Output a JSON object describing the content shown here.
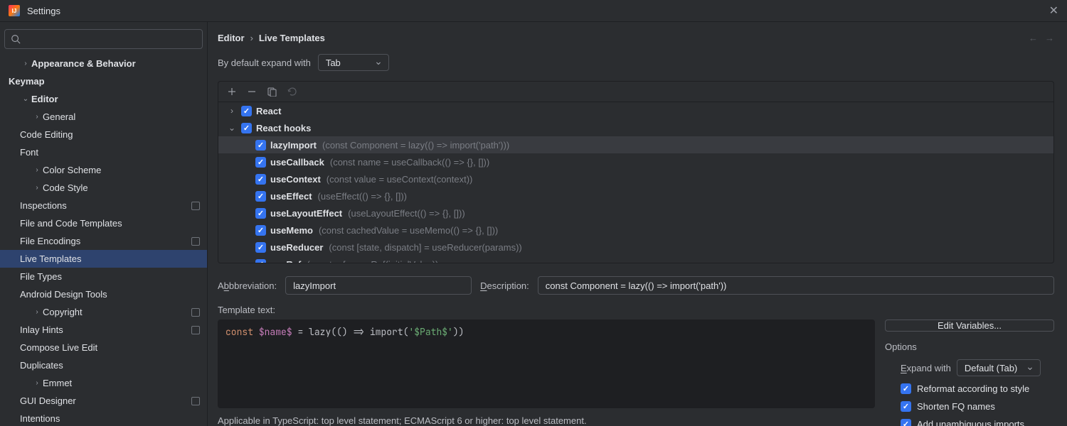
{
  "window": {
    "title": "Settings"
  },
  "search": {
    "placeholder": ""
  },
  "sidebar": [
    {
      "label": "Appearance & Behavior",
      "indent": 1,
      "chev": "›",
      "bold": true
    },
    {
      "label": "Keymap",
      "indent": 1,
      "bold": true
    },
    {
      "label": "Editor",
      "indent": 1,
      "chev": "⌄",
      "bold": true
    },
    {
      "label": "General",
      "indent": 2,
      "chev": "›"
    },
    {
      "label": "Code Editing",
      "indent": 2
    },
    {
      "label": "Font",
      "indent": 2
    },
    {
      "label": "Color Scheme",
      "indent": 2,
      "chev": "›"
    },
    {
      "label": "Code Style",
      "indent": 2,
      "chev": "›"
    },
    {
      "label": "Inspections",
      "indent": 2,
      "mod": true
    },
    {
      "label": "File and Code Templates",
      "indent": 2
    },
    {
      "label": "File Encodings",
      "indent": 2,
      "mod": true
    },
    {
      "label": "Live Templates",
      "indent": 2,
      "selected": true
    },
    {
      "label": "File Types",
      "indent": 2
    },
    {
      "label": "Android Design Tools",
      "indent": 2
    },
    {
      "label": "Copyright",
      "indent": 2,
      "chev": "›",
      "mod": true
    },
    {
      "label": "Inlay Hints",
      "indent": 2,
      "mod": true
    },
    {
      "label": "Compose Live Edit",
      "indent": 2
    },
    {
      "label": "Duplicates",
      "indent": 2
    },
    {
      "label": "Emmet",
      "indent": 2,
      "chev": "›"
    },
    {
      "label": "GUI Designer",
      "indent": 2,
      "mod": true
    },
    {
      "label": "Intentions",
      "indent": 2
    }
  ],
  "breadcrumb": {
    "a": "Editor",
    "b": "Live Templates"
  },
  "expand": {
    "label": "By default expand with",
    "value": "Tab"
  },
  "groups": [
    {
      "name": "React",
      "expanded": false
    },
    {
      "name": "React hooks",
      "expanded": true
    }
  ],
  "templates": [
    {
      "name": "lazyImport",
      "desc": "(const Component = lazy(() => import('path')))",
      "sel": true
    },
    {
      "name": "useCallback",
      "desc": "(const name = useCallback(() => {}, []))"
    },
    {
      "name": "useContext",
      "desc": "(const value = useContext(context))"
    },
    {
      "name": "useEffect",
      "desc": "(useEffect(() => {}, []))"
    },
    {
      "name": "useLayoutEffect",
      "desc": "(useLayoutEffect(() => {}, []))"
    },
    {
      "name": "useMemo",
      "desc": "(const cachedValue = useMemo(() => {}, []))"
    },
    {
      "name": "useReducer",
      "desc": "(const [state, dispatch] = useReducer(params))"
    },
    {
      "name": "useRef",
      "desc": "(const ref = useRef(initialValue))"
    }
  ],
  "form": {
    "abbr_label": "bbreviation:",
    "abbr_value": "lazyImport",
    "desc_label": "escription:",
    "desc_value": "const Component = lazy(() => import('path'))",
    "text_label": "emplate text:"
  },
  "code": {
    "kw": "const",
    "var1": "$name$",
    "mid": " = lazy(() => import(",
    "str": "'$Path$'",
    "end": "))"
  },
  "right": {
    "edit_vars": "Edit Variables...",
    "options": "Options",
    "expand_label": "xpand with",
    "expand_value": "Default (Tab)",
    "opt1": "Reformat according to style",
    "opt2": "Shorten FQ names",
    "opt3": "Add unambiguous imports"
  },
  "applicable": "Applicable in TypeScript: top level statement; ECMAScript 6 or higher: top level statement."
}
